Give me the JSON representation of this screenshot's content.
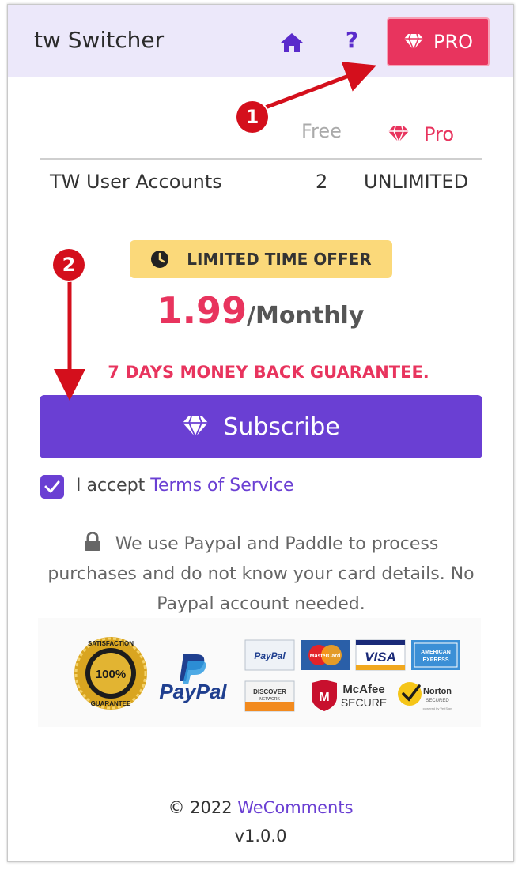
{
  "header": {
    "title": "tw Switcher",
    "help_label": "?",
    "pro_label": "PRO",
    "home_icon": "home-icon",
    "diamond_icon": "diamond-icon"
  },
  "comparison": {
    "free_header": "Free",
    "pro_header": "Pro",
    "rows": [
      {
        "label": "TW User Accounts",
        "free": "2",
        "pro": "UNLIMITED"
      }
    ]
  },
  "offer": {
    "badge": "LIMITED TIME OFFER",
    "price": "1.99",
    "period": "/Monthly",
    "guarantee": "7 DAYS MONEY BACK GUARANTEE."
  },
  "subscribe": {
    "label": "Subscribe",
    "accepted": true,
    "accept_text": "I accept ",
    "terms_link": "Terms of Service"
  },
  "security": {
    "text": "We use Paypal and Paddle to process purchases and do not know your card details. No Paypal account needed."
  },
  "badges": {
    "seal_top": "SATISFACTION",
    "seal_mid": "100%",
    "seal_bottom": "GUARANTEE",
    "paypal": "PayPal",
    "paypal_small": "PayPal",
    "mastercard": "MasterCard",
    "visa": "VISA",
    "amex_line1": "AMERICAN",
    "amex_line2": "EXPRESS",
    "discover_line1": "DISCOVER",
    "discover_line2": "NETWORK",
    "mcafee_line1": "McAfee",
    "mcafee_line2": "SECURE",
    "norton_line1": "Norton",
    "norton_line2": "SECURED",
    "norton_line3": "powered by VeriSign"
  },
  "footer": {
    "copyright": "© 2022 ",
    "company_link": "WeComments",
    "version": "v1.0.0"
  },
  "annotations": {
    "step1": "1",
    "step2": "2"
  },
  "colors": {
    "accent": "#6a3fd3",
    "pro": "#e8345e",
    "header_bg": "#ece8fa",
    "offer_bg": "#fbd97a",
    "annotation": "#d40f1c"
  }
}
